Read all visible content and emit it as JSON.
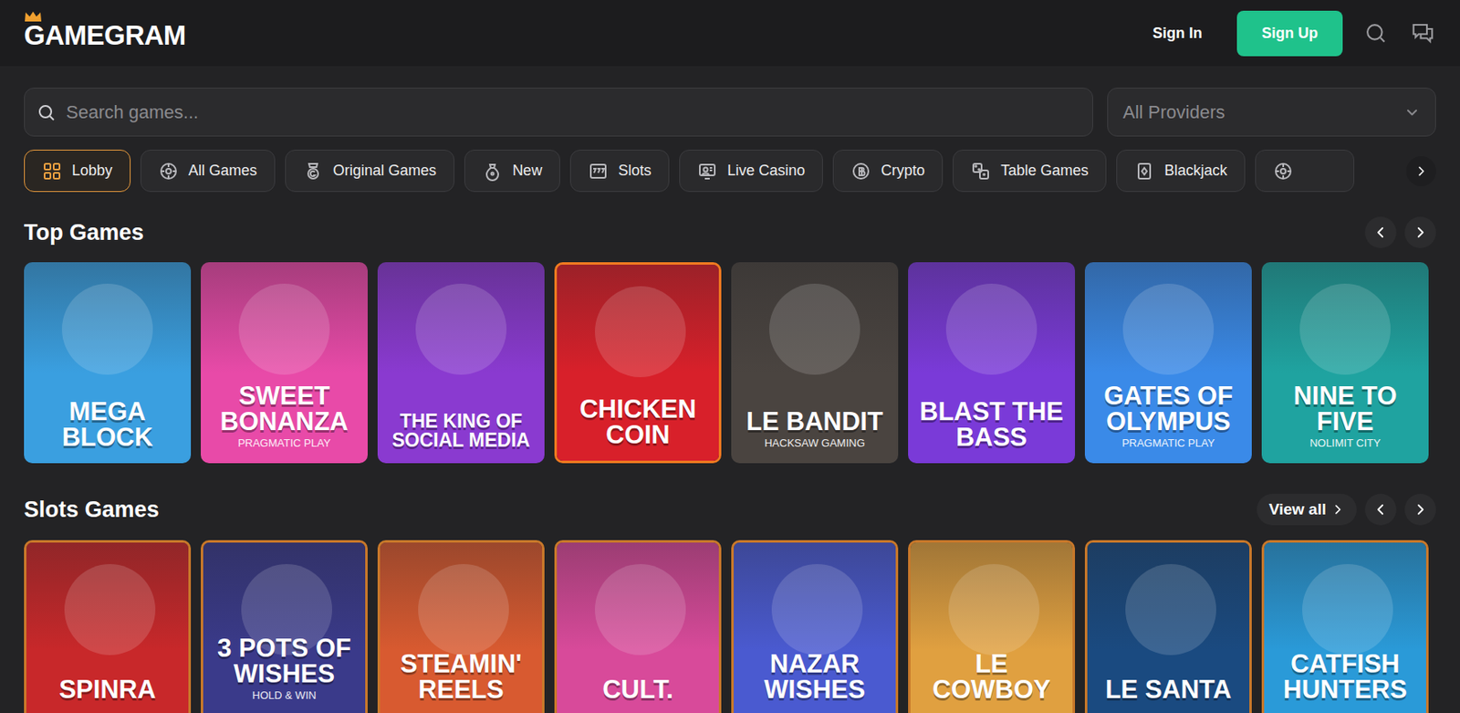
{
  "header": {
    "logo": "GAMEGRAM",
    "sign_in": "Sign In",
    "sign_up": "Sign Up"
  },
  "search": {
    "placeholder": "Search games..."
  },
  "providers": {
    "value": "All Providers"
  },
  "categories": [
    {
      "label": "Lobby",
      "selected": true
    },
    {
      "label": "All Games",
      "selected": false
    },
    {
      "label": "Original Games",
      "selected": false
    },
    {
      "label": "New",
      "selected": false
    },
    {
      "label": "Slots",
      "selected": false
    },
    {
      "label": "Live Casino",
      "selected": false
    },
    {
      "label": "Crypto",
      "selected": false
    },
    {
      "label": "Table Games",
      "selected": false
    },
    {
      "label": "Blackjack",
      "selected": false
    }
  ],
  "top_games": {
    "title": "Top Games",
    "games": [
      {
        "title": "MEGA BLOCK",
        "subtitle": "",
        "color": "#3a9fe0",
        "highlighted": false
      },
      {
        "title": "SWEET BONANZA",
        "subtitle": "PRAGMATIC PLAY",
        "color": "#e84aa8",
        "highlighted": false
      },
      {
        "title": "THE KING OF SOCIAL MEDIA",
        "subtitle": "",
        "color": "#8a3ad0",
        "highlighted": false
      },
      {
        "title": "CHICKEN COIN",
        "subtitle": "",
        "color": "#d8202a",
        "highlighted": true
      },
      {
        "title": "LE BANDIT",
        "subtitle": "HACKSAW GAMING",
        "color": "#4a4440",
        "highlighted": false
      },
      {
        "title": "BLAST THE BASS",
        "subtitle": "",
        "color": "#7a3ad8",
        "highlighted": false
      },
      {
        "title": "GATES OF OLYMPUS",
        "subtitle": "PRAGMATIC PLAY",
        "color": "#3a8ae8",
        "highlighted": false
      },
      {
        "title": "NINE TO FIVE",
        "subtitle": "NOLIMIT CITY",
        "color": "#1fa3a0",
        "highlighted": false
      }
    ]
  },
  "slots_games": {
    "title": "Slots Games",
    "view_all": "View all",
    "games": [
      {
        "title": "SPINRA",
        "subtitle": "",
        "color": "#c8282a"
      },
      {
        "title": "3 POTS OF WISHES",
        "subtitle": "HOLD & WIN",
        "color": "#3a3a8a"
      },
      {
        "title": "STEAMIN' REELS",
        "subtitle": "",
        "color": "#d85a30"
      },
      {
        "title": "CULT.",
        "subtitle": "",
        "color": "#d84a9a"
      },
      {
        "title": "NAZAR WISHES",
        "subtitle": "",
        "color": "#4a5ad0"
      },
      {
        "title": "LE COWBOY",
        "subtitle": "",
        "color": "#e0a040"
      },
      {
        "title": "LE SANTA",
        "subtitle": "",
        "color": "#1a4a80"
      },
      {
        "title": "CATFISH HUNTERS",
        "subtitle": "",
        "color": "#2a9ad8"
      }
    ]
  }
}
